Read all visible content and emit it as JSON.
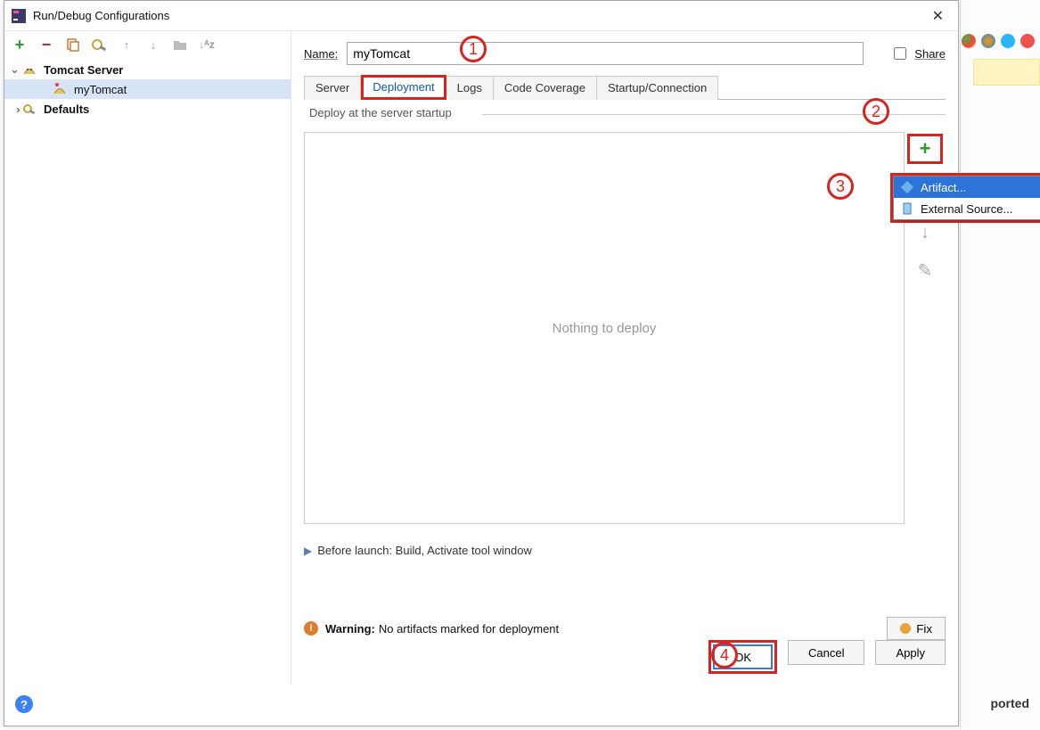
{
  "window": {
    "title": "Run/Debug Configurations"
  },
  "toolbar_icons": [
    "add",
    "remove",
    "copy",
    "wrench",
    "up",
    "down",
    "folder",
    "sort"
  ],
  "tree": {
    "tomcat_server": "Tomcat Server",
    "my_tomcat": "myTomcat",
    "defaults": "Defaults"
  },
  "form": {
    "name_label": "Name:",
    "name_value": "myTomcat",
    "share_label": "Share"
  },
  "tabs": {
    "server": "Server",
    "deployment": "Deployment",
    "logs": "Logs",
    "code_coverage": "Code Coverage",
    "startup": "Startup/Connection"
  },
  "deploy": {
    "group_label": "Deploy at the server startup",
    "empty_text": "Nothing to deploy"
  },
  "popup": {
    "artifact": "Artifact...",
    "external": "External Source..."
  },
  "before_launch": "Before launch: Build, Activate tool window",
  "warning": {
    "label": "Warning:",
    "text": "No artifacts marked for deployment",
    "fix": "Fix"
  },
  "buttons": {
    "ok": "OK",
    "cancel": "Cancel",
    "apply": "Apply"
  },
  "annotations": {
    "a1": "1",
    "a2": "2",
    "a3": "3",
    "a4": "4"
  },
  "bg": {
    "ported": "ported"
  }
}
